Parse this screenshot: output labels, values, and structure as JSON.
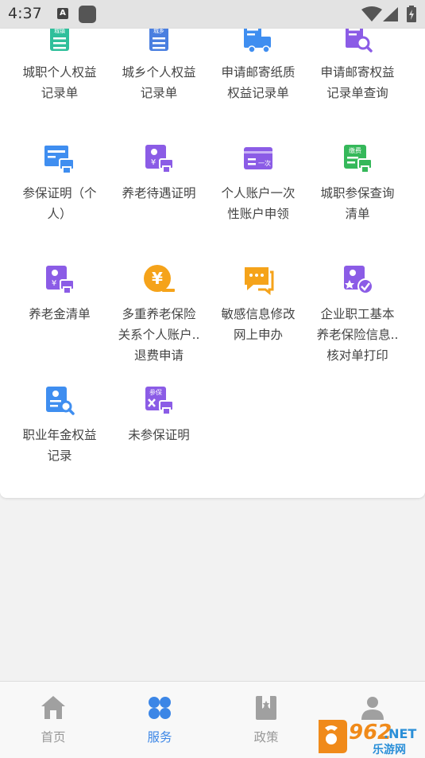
{
  "status_bar": {
    "time": "4:37",
    "notification_letter": "A"
  },
  "services": [
    {
      "label": "城职个人权益\n记录单",
      "icon": "urban-rights-record-icon",
      "color": "#2fbf9b"
    },
    {
      "label": "城乡个人权益\n记录单",
      "icon": "rural-rights-record-icon",
      "color": "#4a7fe0"
    },
    {
      "label": "申请邮寄纸质\n权益记录单",
      "icon": "mail-delivery-truck-icon",
      "color": "#3f8ef0"
    },
    {
      "label": "申请邮寄权益\n记录单查询",
      "icon": "mail-record-search-icon",
      "color": "#8b5ce6"
    },
    {
      "label": "参保证明（个\n人）",
      "icon": "insurance-certificate-print-icon",
      "color": "#3f8ef0"
    },
    {
      "label": "养老待遇证明",
      "icon": "pension-benefit-print-icon",
      "color": "#8b5ce6"
    },
    {
      "label": "个人账户一次\n性账户申领",
      "icon": "one-time-account-card-icon",
      "color": "#8b5ce6"
    },
    {
      "label": "城职参保查询\n清单",
      "icon": "insurance-payment-print-icon",
      "color": "#35b85a"
    },
    {
      "label": "养老金清单",
      "icon": "pension-list-print-icon",
      "color": "#8b5ce6"
    },
    {
      "label": "多重养老保险\n关系个人账户..\n退费申请",
      "icon": "refund-yen-icon",
      "color": "#f5a31a"
    },
    {
      "label": "敏感信息修改\n网上申办",
      "icon": "sensitive-info-chat-icon",
      "color": "#f5a31a"
    },
    {
      "label": "企业职工基本\n养老保险信息..\n核对单打印",
      "icon": "enterprise-pension-check-icon",
      "color": "#8b5ce6"
    },
    {
      "label": "职业年金权益\n记录",
      "icon": "occupational-annuity-search-icon",
      "color": "#3f8ef0"
    },
    {
      "label": "未参保证明",
      "icon": "uninsured-certificate-print-icon",
      "color": "#8b5ce6"
    }
  ],
  "icon_text": {
    "urban": "城镇",
    "rural": "城乡",
    "once": "一次",
    "pay": "缴费",
    "join": "参保",
    "yen": "¥"
  },
  "tabs": [
    {
      "label": "首页",
      "icon": "home-icon",
      "active": false
    },
    {
      "label": "服务",
      "icon": "services-grid-icon",
      "active": true
    },
    {
      "label": "政策",
      "icon": "policy-bookmark-icon",
      "active": false
    },
    {
      "label": "",
      "icon": "profile-person-icon",
      "active": false
    }
  ],
  "watermark": {
    "brand_number": "962",
    "brand_suffix": ".NET",
    "brand_name": "乐游网"
  },
  "colors": {
    "accent": "#3c86e6",
    "tab_inactive": "#999999",
    "label": "#444444"
  }
}
